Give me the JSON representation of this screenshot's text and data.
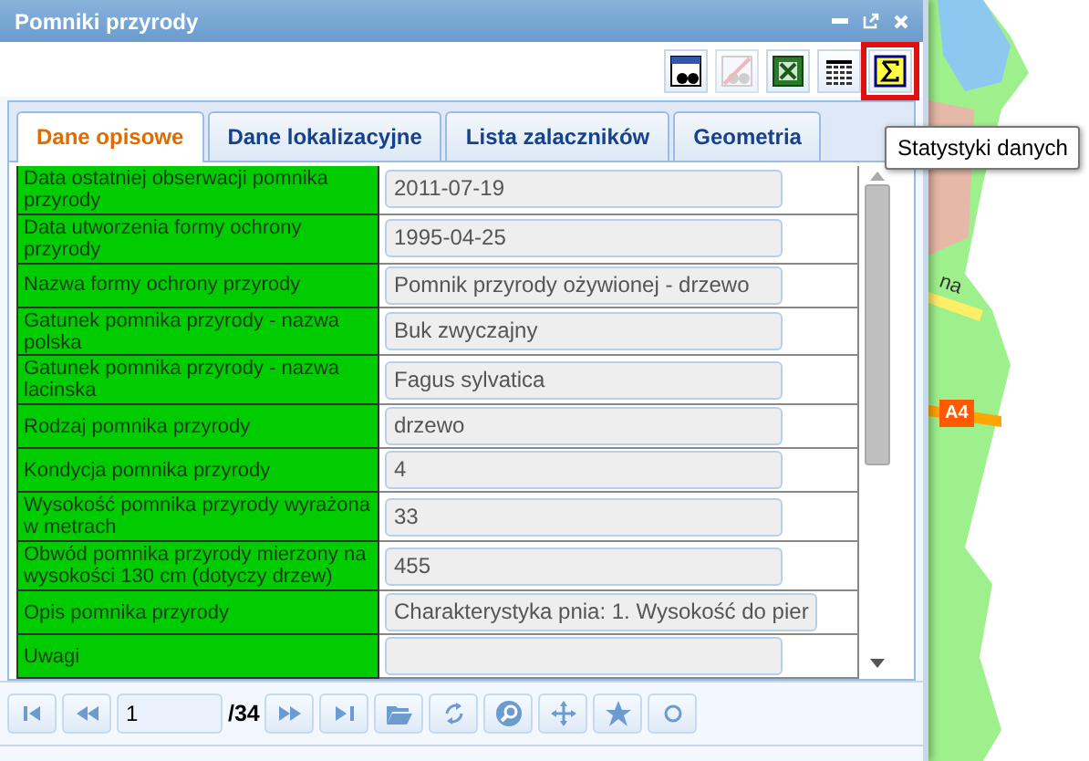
{
  "window": {
    "title": "Pomniki przyrody"
  },
  "toolbar": {
    "buttons": [
      {
        "kind": "search-table",
        "disabled": false,
        "highlighted": false
      },
      {
        "kind": "clear-search",
        "disabled": true,
        "highlighted": false
      },
      {
        "kind": "excel",
        "disabled": false,
        "highlighted": false
      },
      {
        "kind": "columns",
        "disabled": false,
        "highlighted": false
      },
      {
        "kind": "sigma",
        "disabled": false,
        "highlighted": true
      }
    ]
  },
  "tooltip": "Statystyki danych",
  "tabs": [
    {
      "label": "Dane opisowe",
      "selected": true
    },
    {
      "label": "Dane lokalizacyjne",
      "selected": false
    },
    {
      "label": "Lista zalaczników",
      "selected": false
    },
    {
      "label": "Geometria",
      "selected": false
    }
  ],
  "rows": [
    {
      "label": "Data ostatniej obserwacji pomnika przyrody",
      "value": "2011-07-19"
    },
    {
      "label": "Data utworzenia formy ochrony przyrody",
      "value": "1995-04-25"
    },
    {
      "label": "Nazwa formy ochrony przyrody",
      "value": "Pomnik przyrody ożywionej - drzewo"
    },
    {
      "label": "Gatunek pomnika przyrody - nazwa polska",
      "value": "Buk zwyczajny"
    },
    {
      "label": "Gatunek pomnika przyrody - nazwa lacinska",
      "value": "Fagus sylvatica"
    },
    {
      "label": "Rodzaj pomnika przyrody",
      "value": "drzewo"
    },
    {
      "label": "Kondycja pomnika przyrody",
      "value": "4"
    },
    {
      "label": "Wysokość pomnika przyrody wyrażona w metrach",
      "value": "33"
    },
    {
      "label": "Obwód pomnika przyrody mierzony na wysokości 130 cm (dotyczy drzew)",
      "value": "455"
    },
    {
      "label": "Opis pomnika przyrody",
      "value": "Charakterystyka pnia: 1. Wysokość do pier"
    },
    {
      "label": "Uwagi",
      "value": ""
    }
  ],
  "pager": {
    "page": "1",
    "total": "/34",
    "buttons": [
      {
        "kind": "first"
      },
      {
        "kind": "prev"
      },
      {
        "kind": "next"
      },
      {
        "kind": "last"
      },
      {
        "kind": "folder"
      },
      {
        "kind": "refresh"
      },
      {
        "kind": "zoom"
      },
      {
        "kind": "move"
      },
      {
        "kind": "star"
      },
      {
        "kind": "circle"
      }
    ]
  },
  "map": {
    "labels": [
      {
        "text": "na",
        "kind": "street"
      },
      {
        "text": "A4",
        "kind": "road-badge"
      }
    ]
  }
}
